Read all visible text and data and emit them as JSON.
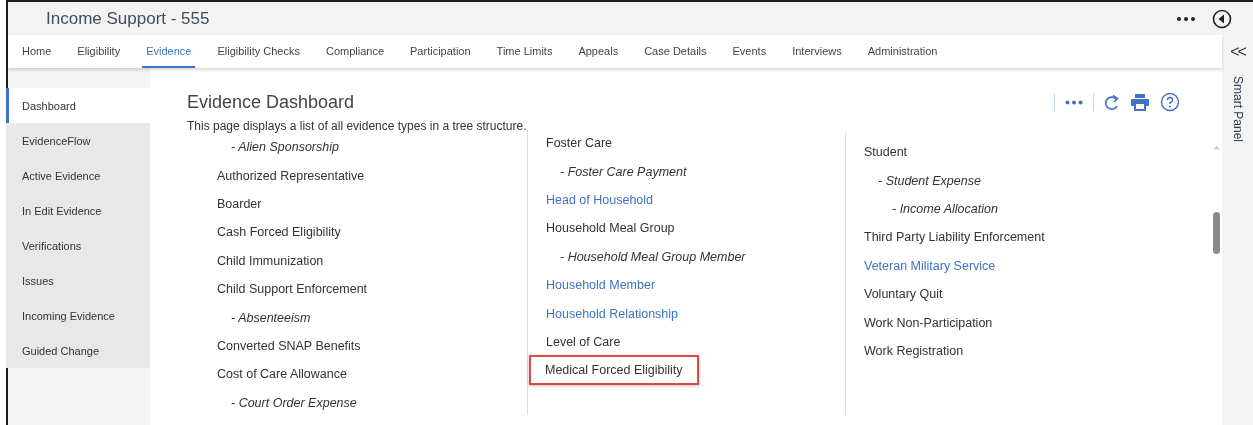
{
  "window": {
    "title": "Income Support - 555"
  },
  "nav_tabs": [
    {
      "label": "Home",
      "selected": false
    },
    {
      "label": "Eligibility",
      "selected": false
    },
    {
      "label": "Evidence",
      "selected": true
    },
    {
      "label": "Eligibility Checks",
      "selected": false
    },
    {
      "label": "Compliance",
      "selected": false
    },
    {
      "label": "Participation",
      "selected": false
    },
    {
      "label": "Time Limits",
      "selected": false
    },
    {
      "label": "Appeals",
      "selected": false
    },
    {
      "label": "Case Details",
      "selected": false
    },
    {
      "label": "Events",
      "selected": false
    },
    {
      "label": "Interviews",
      "selected": false
    },
    {
      "label": "Administration",
      "selected": false
    }
  ],
  "smart_panel": {
    "toggle": "<<",
    "label": "Smart Panel"
  },
  "sidebar": {
    "items": [
      {
        "label": "Dashboard",
        "selected": true
      },
      {
        "label": "EvidenceFlow",
        "selected": false
      },
      {
        "label": "Active Evidence",
        "selected": false
      },
      {
        "label": "In Edit Evidence",
        "selected": false
      },
      {
        "label": "Verifications",
        "selected": false
      },
      {
        "label": "Issues",
        "selected": false
      },
      {
        "label": "Incoming Evidence",
        "selected": false
      },
      {
        "label": "Guided Change",
        "selected": false
      }
    ]
  },
  "page": {
    "title": "Evidence Dashboard",
    "description": "This page displays a list of all evidence types in a tree structure."
  },
  "tree_columns": [
    [
      {
        "children": [
          {
            "label": "- Alien Sponsorship"
          }
        ]
      },
      {
        "label": "Authorized Representative",
        "link": false
      },
      {
        "label": "Boarder",
        "link": false
      },
      {
        "label": "Cash Forced Eligibility",
        "link": false
      },
      {
        "label": "Child Immunization",
        "link": false
      },
      {
        "label": "Child Support Enforcement",
        "link": false,
        "children": [
          {
            "label": "- Absenteeism"
          }
        ]
      },
      {
        "label": "Converted SNAP Benefits",
        "link": false
      },
      {
        "label": "Cost of Care Allowance",
        "link": false,
        "children": [
          {
            "label": "- Court Order Expense"
          }
        ]
      }
    ],
    [
      {
        "label": "Foster Care",
        "link": false,
        "children": [
          {
            "label": "- Foster Care Payment"
          }
        ]
      },
      {
        "label": "Head of Household",
        "link": true
      },
      {
        "label": "Household Meal Group",
        "link": false,
        "children": [
          {
            "label": "- Household Meal Group Member"
          }
        ]
      },
      {
        "label": "Household Member",
        "link": true
      },
      {
        "label": "Household Relationship",
        "link": true
      },
      {
        "label": "Level of Care",
        "link": false
      },
      {
        "label": "Medical Forced Eligibility",
        "link": false,
        "highlighted": true
      }
    ],
    [
      {
        "label": "Student",
        "link": false,
        "children": [
          {
            "label": "- Student Expense",
            "children": [
              {
                "label": "- Income Allocation"
              }
            ]
          }
        ]
      },
      {
        "label": "Third Party Liability Enforcement",
        "link": false
      },
      {
        "label": "Veteran Military Service",
        "link": true
      },
      {
        "label": "Voluntary Quit",
        "link": false
      },
      {
        "label": "Work Non-Participation",
        "link": false
      },
      {
        "label": "Work Registration",
        "link": false
      }
    ]
  ]
}
